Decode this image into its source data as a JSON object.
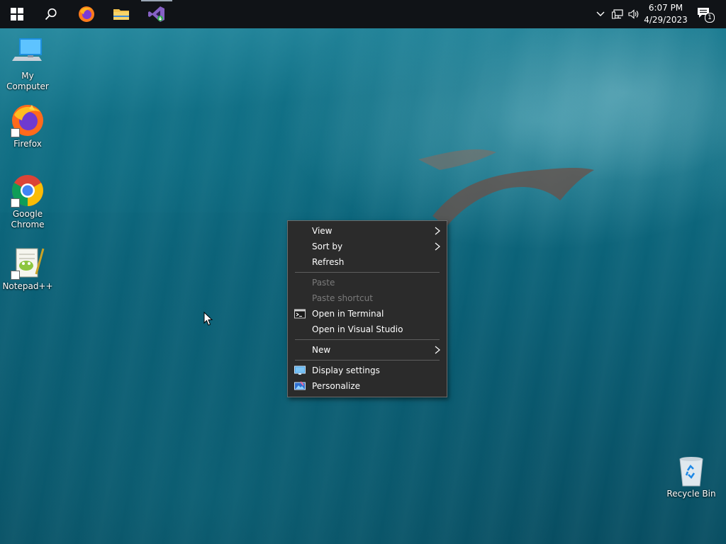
{
  "taskbar": {
    "pinned": [
      {
        "name": "Start",
        "icon": "windows-start-icon"
      },
      {
        "name": "Search",
        "icon": "search-icon"
      },
      {
        "name": "Firefox",
        "icon": "firefox-icon"
      },
      {
        "name": "File Explorer",
        "icon": "folder-icon"
      },
      {
        "name": "Visual Studio",
        "icon": "visual-studio-icon",
        "active": true
      }
    ],
    "clock": {
      "time": "6:07 PM",
      "date": "4/29/2023"
    },
    "notification_count": "1"
  },
  "desktop_icons": [
    {
      "label": "My Computer",
      "icon": "computer-icon"
    },
    {
      "label": "Firefox",
      "icon": "firefox-icon"
    },
    {
      "label": "Google Chrome",
      "icon": "chrome-icon"
    },
    {
      "label": "Notepad++",
      "icon": "notepadpp-icon"
    },
    {
      "label": "Recycle Bin",
      "icon": "recycle-bin-icon"
    }
  ],
  "context_menu": {
    "items": [
      {
        "label": "View",
        "submenu": true
      },
      {
        "label": "Sort by",
        "submenu": true
      },
      {
        "label": "Refresh"
      },
      {
        "label": "Paste",
        "disabled": true
      },
      {
        "label": "Paste shortcut",
        "disabled": true
      },
      {
        "label": "Open in Terminal",
        "icon": "terminal-icon"
      },
      {
        "label": "Open in Visual Studio"
      },
      {
        "label": "New",
        "submenu": true
      },
      {
        "label": "Display settings",
        "icon": "display-icon"
      },
      {
        "label": "Personalize",
        "icon": "personalize-icon"
      }
    ]
  },
  "colors": {
    "taskbar": "#101317",
    "menu_bg": "#2b2b2b",
    "menu_border": "#6b6b6b",
    "menu_text": "#ffffff",
    "menu_disabled": "#7a7a7a",
    "wallpaper": "#0d6a80"
  }
}
